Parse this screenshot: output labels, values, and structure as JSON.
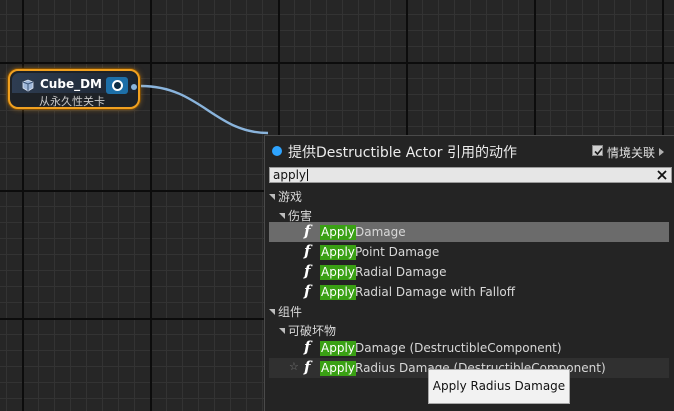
{
  "node": {
    "name": "Cube_DM",
    "subtitle": "从永久性关卡",
    "icon": "actor-icon"
  },
  "menu": {
    "title": "提供Destructible Actor 引用的动作",
    "context_label": "情境关联",
    "context_checked": true,
    "search_value": "apply",
    "categories": [
      {
        "label": "游戏",
        "subcategory": "伤害",
        "items": [
          {
            "match": "Apply",
            "rest": "Damage",
            "selected": true
          },
          {
            "match": "Apply",
            "rest": "Point Damage"
          },
          {
            "match": "Apply",
            "rest": "Radial Damage"
          },
          {
            "match": "Apply",
            "rest": "Radial Damage with Falloff"
          }
        ]
      },
      {
        "label": "组件",
        "subcategory": "可破坏物",
        "items": [
          {
            "match": "Apply",
            "rest": "Damage (DestructibleComponent)"
          },
          {
            "match": "Apply",
            "rest": "Radius Damage (DestructibleComponent)",
            "hovered": true
          }
        ]
      }
    ],
    "function_glyph": "f"
  },
  "tooltip": {
    "text": "Apply Radius Damage"
  },
  "colors": {
    "node_border": "#f0a020",
    "wire": "#8ab4dc",
    "highlight": "#3aa014",
    "selected_row": "#6b6b6b",
    "title_dot": "#2ea4ff"
  }
}
